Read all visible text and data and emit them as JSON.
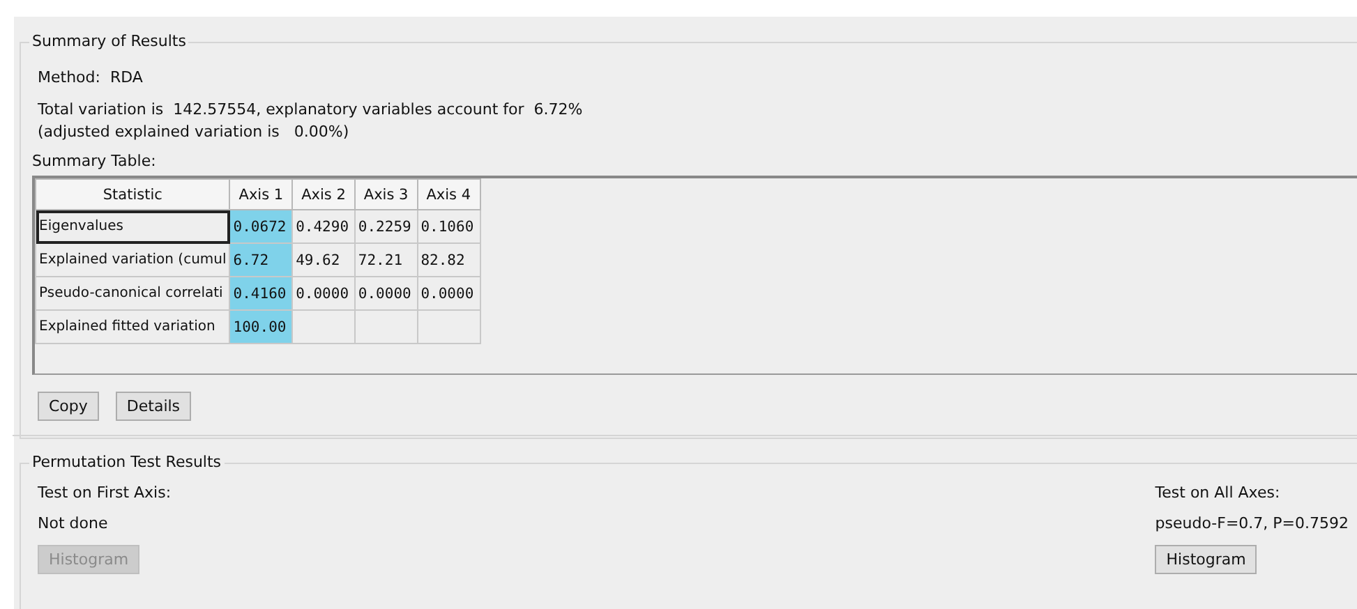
{
  "summary": {
    "title": "Summary of Results",
    "method_label": "Method:",
    "method_value": "RDA",
    "total_line": "Total variation is  142.57554, explanatory variables account for  6.72%",
    "adjusted_line": "(adjusted explained variation is   0.00%)",
    "table_label": "Summary Table:",
    "table": {
      "columns": [
        {
          "label": "Statistic",
          "selected": false
        },
        {
          "label": "Axis 1",
          "selected": true
        },
        {
          "label": "Axis 2",
          "selected": false
        },
        {
          "label": "Axis 3",
          "selected": false
        },
        {
          "label": "Axis 4",
          "selected": false
        }
      ],
      "rows": [
        {
          "focused": true,
          "cells": [
            "Eigenvalues",
            "0.0672",
            "0.4290",
            "0.2259",
            "0.1060"
          ]
        },
        {
          "focused": false,
          "cells": [
            "Explained variation (cumul",
            "6.72",
            "49.62",
            "72.21",
            "82.82"
          ]
        },
        {
          "focused": false,
          "cells": [
            "Pseudo-canonical correlati",
            "0.4160",
            "0.0000",
            "0.0000",
            "0.0000"
          ]
        },
        {
          "focused": false,
          "cells": [
            "Explained fitted variation",
            "100.00",
            "",
            "",
            ""
          ]
        }
      ]
    },
    "buttons": [
      {
        "label": "Copy",
        "disabled": false
      },
      {
        "label": "Details",
        "disabled": false
      }
    ]
  },
  "permutation": {
    "title": "Permutation Test Results",
    "first_axis": {
      "label": "Test on First Axis:",
      "result": "Not done",
      "button": {
        "label": "Histogram",
        "disabled": true
      }
    },
    "all_axes": {
      "label": "Test on All Axes:",
      "result": "pseudo-F=0.7, P=0.7592",
      "button": {
        "label": "Histogram",
        "disabled": false
      }
    }
  }
}
